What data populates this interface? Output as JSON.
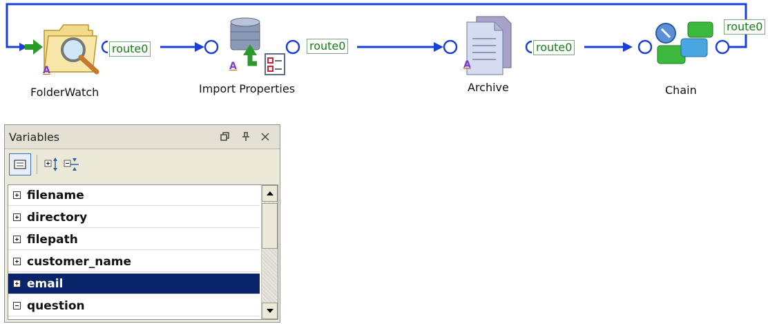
{
  "workflow": {
    "nodes": [
      {
        "label": "FolderWatch",
        "icon": "folder-watch-icon",
        "marker": "A"
      },
      {
        "label": "Import Properties",
        "icon": "import-properties-icon",
        "marker": "A"
      },
      {
        "label": "Archive",
        "icon": "archive-icon",
        "marker": "A"
      },
      {
        "label": "Chain",
        "icon": "chain-icon"
      }
    ],
    "routes": [
      "route0",
      "route0",
      "route0",
      "route0"
    ],
    "colors": {
      "connector": "#1a3fd6",
      "route_text": "#1a7a1a",
      "start_arrow": "#2a9a2a"
    }
  },
  "variables_panel": {
    "title": "Variables",
    "controls": {
      "float": "float-window-icon",
      "pin": "pin-icon",
      "close": "close-icon"
    },
    "toolbar": [
      "list-view-icon",
      "expand-all-icon",
      "collapse-all-icon"
    ],
    "items": [
      {
        "name": "filename",
        "expanded": false,
        "selected": false
      },
      {
        "name": "directory",
        "expanded": false,
        "selected": false
      },
      {
        "name": "filepath",
        "expanded": false,
        "selected": false
      },
      {
        "name": "customer_name",
        "expanded": false,
        "selected": false
      },
      {
        "name": "email",
        "expanded": false,
        "selected": true
      },
      {
        "name": "question",
        "expanded": true,
        "selected": false
      }
    ],
    "colors": {
      "selection": "#0a246a",
      "panel_bg": "#ece9d8"
    }
  }
}
